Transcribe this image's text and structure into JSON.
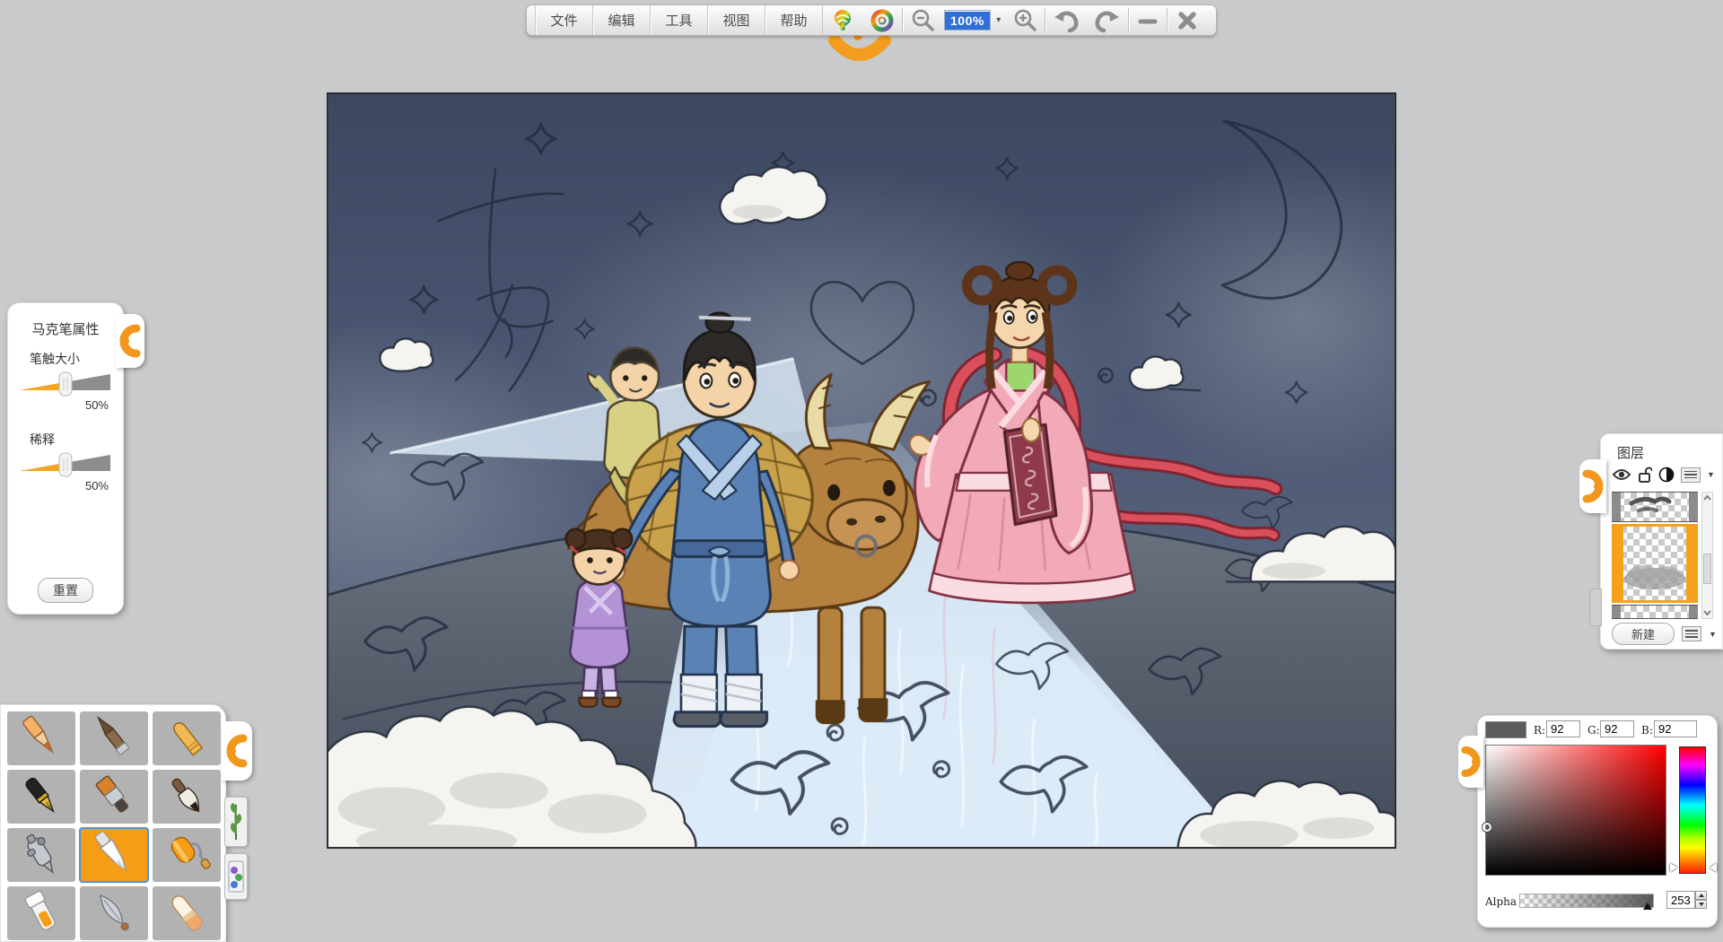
{
  "toolbar": {
    "menus": [
      "文件",
      "编辑",
      "工具",
      "视图",
      "帮助"
    ],
    "zoom_value": "100%",
    "icons": [
      "rainbow-tree-icon",
      "rainbow-ring-icon",
      "zoom-out-icon",
      "zoom-in-icon",
      "undo-icon",
      "redo-icon",
      "minimize-icon",
      "close-icon",
      "smiley-handle"
    ]
  },
  "marker_panel": {
    "title": "马克笔属性",
    "sliders": [
      {
        "label": "笔触大小",
        "value": "50%"
      },
      {
        "label": "稀释",
        "value": "50%"
      }
    ],
    "reset_label": "重置"
  },
  "tool_panel": {
    "tools": [
      "colored-pencil",
      "charcoal-stick",
      "crayon",
      "fountain-pen",
      "flat-brush",
      "ink-brush",
      "airbrush",
      "marker",
      "paint-roller",
      "paint-bottle",
      "knife-pen",
      "eraser"
    ],
    "selected_tool": "marker",
    "side_tabs": [
      "plant-stamp",
      "sticker-picture"
    ]
  },
  "layers_panel": {
    "title": "图层",
    "new_button_label": "新建",
    "icons": [
      "eye-icon",
      "unlock-icon",
      "opacity-icon",
      "menu-icon"
    ]
  },
  "color_picker": {
    "current_color": "#5c5c5c",
    "r_label": "R:",
    "r_value": "92",
    "g_label": "G:",
    "g_value": "92",
    "b_label": "B:",
    "b_value": "92",
    "alpha_label": "Alpha",
    "alpha_value": "253"
  },
  "canvas": {
    "sketch_characters": [
      "七",
      "夕"
    ],
    "scene": "qixi-cowherd-weaver-girl-illustration"
  }
}
